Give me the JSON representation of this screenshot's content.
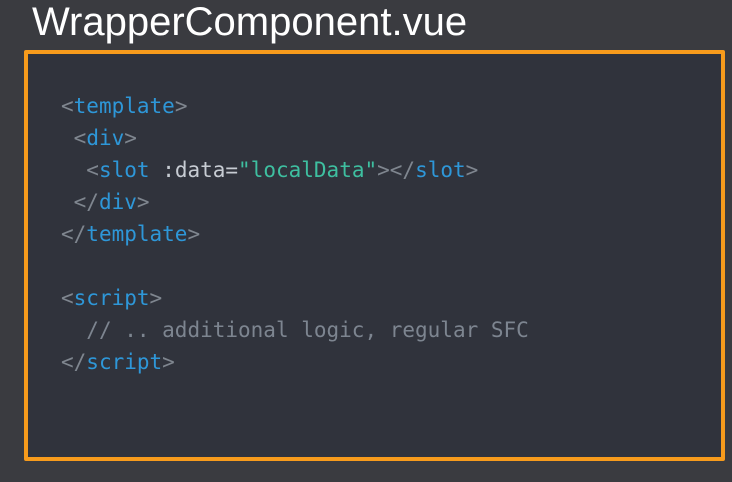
{
  "file": {
    "title": "WrapperComponent.vue"
  },
  "code": {
    "template_open_tag": "template",
    "div_open_tag": "div",
    "slot_tag": "slot",
    "slot_attr_name": ":data=",
    "slot_attr_value": "\"localData\"",
    "div_close_tag": "div",
    "template_close_tag": "template",
    "script_open_tag": "script",
    "script_comment": "// .. additional logic, regular SFC",
    "script_close_tag": "script"
  },
  "colors": {
    "background": "#3a3b40",
    "code_background": "#30333c",
    "frame_border": "#f79b1c",
    "tag": "#2e97d8",
    "punctuation": "#7f868f",
    "attribute": "#c7ccd3",
    "string": "#3ebfa0",
    "comment": "#7d8590"
  }
}
